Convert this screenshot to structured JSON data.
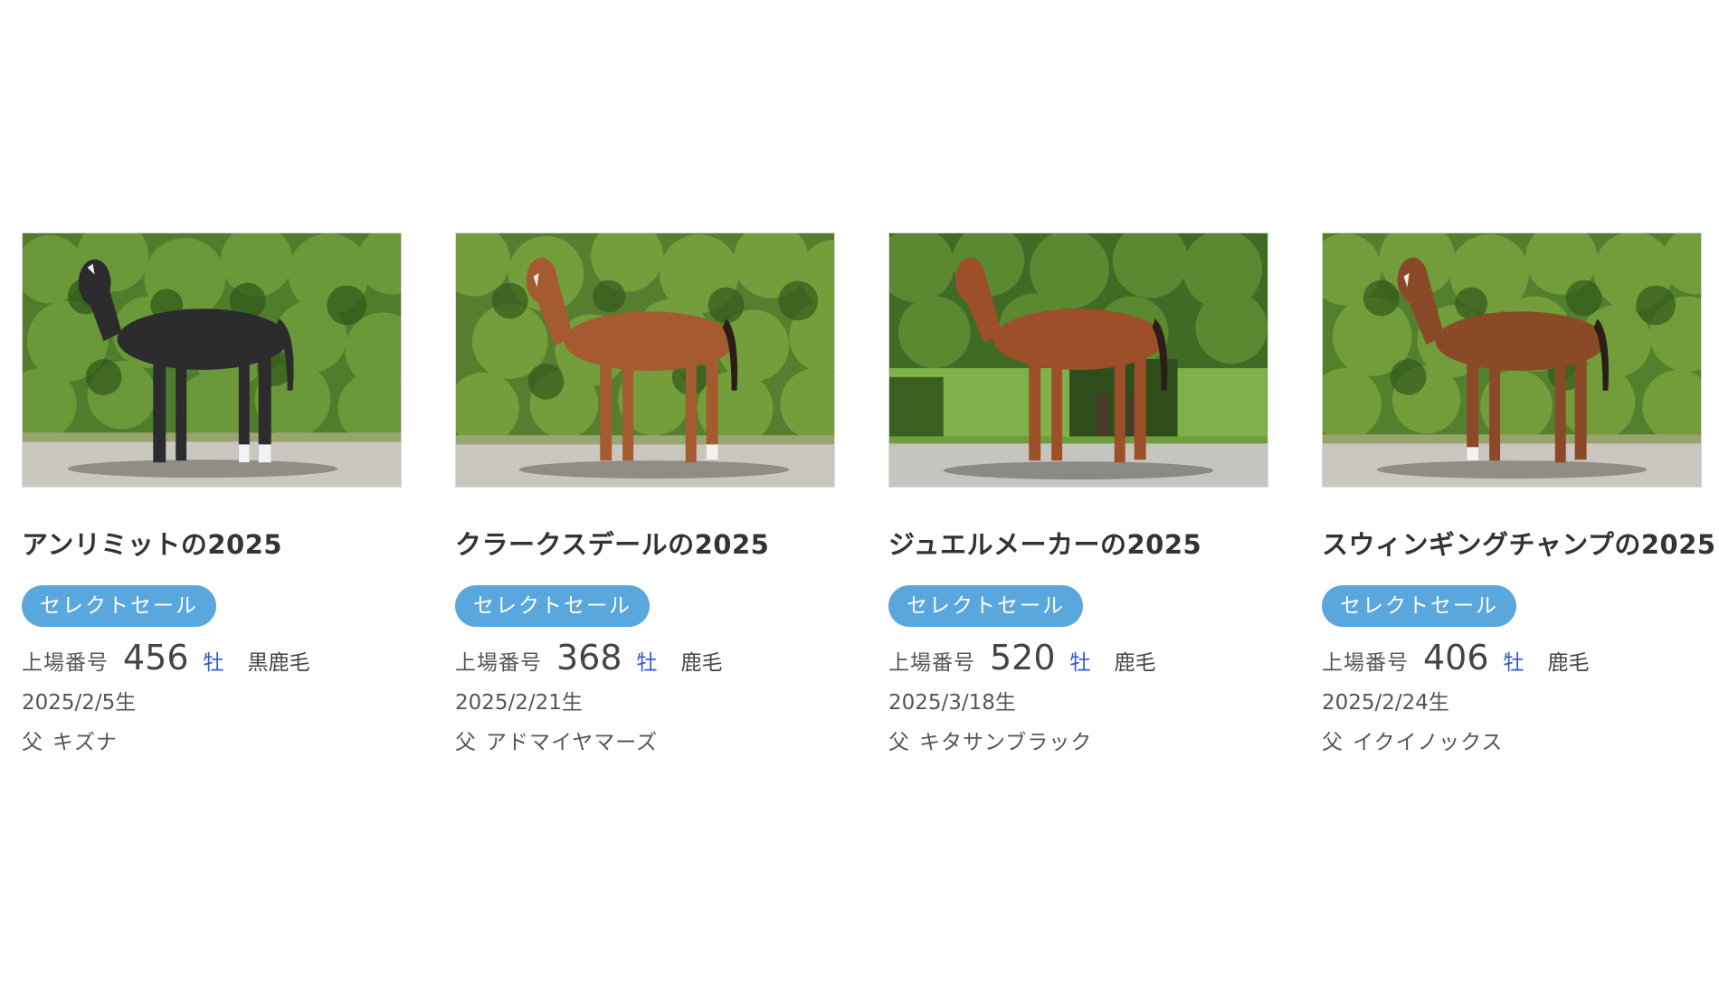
{
  "colors": {
    "badge_bg": "#5aa7dd",
    "sex_text": "#2f5bd3",
    "title_text": "#333333"
  },
  "cards": [
    {
      "name": "アンリミットの2025",
      "badge": "セレクトセール",
      "lot_label": "上場番号",
      "lot_number": "456",
      "sex": "牡",
      "coat": "黒鹿毛",
      "birth": "2025/2/5生",
      "sire_prefix": "父",
      "sire": "キズナ",
      "photo_icon": "foal-photo"
    },
    {
      "name": "クラークスデールの2025",
      "badge": "セレクトセール",
      "lot_label": "上場番号",
      "lot_number": "368",
      "sex": "牡",
      "coat": "鹿毛",
      "birth": "2025/2/21生",
      "sire_prefix": "父",
      "sire": "アドマイヤマーズ",
      "photo_icon": "foal-photo"
    },
    {
      "name": "ジュエルメーカーの2025",
      "badge": "セレクトセール",
      "lot_label": "上場番号",
      "lot_number": "520",
      "sex": "牡",
      "coat": "鹿毛",
      "birth": "2025/3/18生",
      "sire_prefix": "父",
      "sire": "キタサンブラック",
      "photo_icon": "foal-photo"
    },
    {
      "name": "スウィンギングチャンプの2025",
      "badge": "セレクトセール",
      "lot_label": "上場番号",
      "lot_number": "406",
      "sex": "牡",
      "coat": "鹿毛",
      "birth": "2025/2/24生",
      "sire_prefix": "父",
      "sire": "イクイノックス",
      "photo_icon": "foal-photo"
    }
  ]
}
